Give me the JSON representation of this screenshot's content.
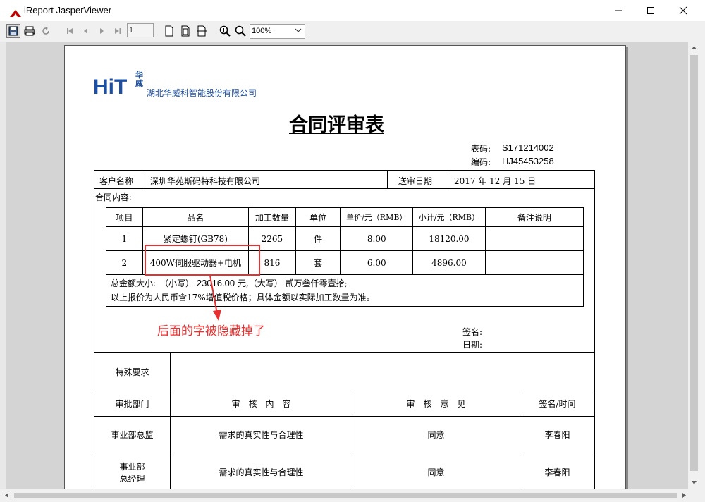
{
  "window": {
    "title": "iReport JasperViewer"
  },
  "toolbar": {
    "page_number": "1",
    "zoom": "100%"
  },
  "report": {
    "company_name": "湖北华威科智能股份有限公司",
    "logo_text": "HiT",
    "logo_side": "华威",
    "title": "合同评审表",
    "form_code_label": "表码:",
    "form_code": "S171214002",
    "code_label": "编码:",
    "code": "HJ45453258",
    "customer_label": "客户名称",
    "customer": "深圳华苑斯码特科技有限公司",
    "submit_date_label": "送审日期",
    "submit_date": "2017 年 12 月 15 日",
    "contract_content_label": "合同内容:",
    "items_header": [
      "项目",
      "品名",
      "加工数量",
      "单位",
      "单价/元（RMB）",
      "小计/元（RMB）",
      "备注说明"
    ],
    "items": [
      {
        "no": "1",
        "name": "紧定螺钉(GB78)",
        "qty": "2265",
        "unit": "件",
        "price": "8.00",
        "subtotal": "18120.00",
        "note": ""
      },
      {
        "no": "2",
        "name": "400W伺服驱动器+电机",
        "qty": "816",
        "unit": "套",
        "price": "6.00",
        "subtotal": "4896.00",
        "note": ""
      }
    ],
    "total_line_prefix": "总金额大小:　（小写）",
    "total_small": "23016.00",
    "total_line_mid": "元,（大写）",
    "total_big": "贰万叁仟零壹拾;",
    "price_note": "以上报价为人民币含17%增值税价格；具体金额以实际加工数量为准。",
    "sign_label": "签名:",
    "date_label": "日期:",
    "special_req_label": "特殊要求",
    "approval_header": [
      "审批部门",
      "审　核　内　容",
      "审　核　意　见",
      "签名/时间"
    ],
    "approvals": [
      {
        "dept": "事业部总监",
        "content": "需求的真实性与合理性",
        "opinion": "同意",
        "signer": "李春阳"
      },
      {
        "dept_line1": "事业部",
        "dept_line2": "总经理",
        "content": "需求的真实性与合理性",
        "opinion": "同意",
        "signer": "李春阳"
      }
    ]
  },
  "annotation": {
    "text": "后面的字被隐藏掉了",
    "color": "#e83030"
  }
}
